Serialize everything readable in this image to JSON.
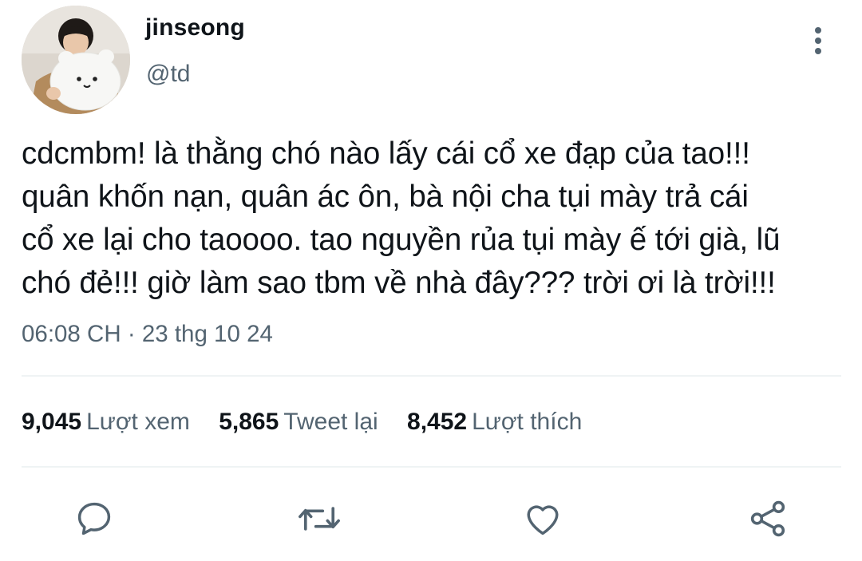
{
  "author": {
    "name": "jinseong",
    "handle": "@td",
    "avatar_icon": "user-photo-avatar"
  },
  "tweet": {
    "text": "cdcmbm! là thằng chó nào lấy cái cổ xe đạp của tao!!!\nquân khốn nạn, quân ác ôn, bà nội cha tụi mày trả cái\ncổ xe lại cho taoooo. tao nguyền rủa tụi mày ế tới già, lũ\nchó đẻ!!! giờ làm sao tbm về nhà đây??? trời ơi là trời!!!",
    "timestamp": "06:08 CH · 23 thg 10 24"
  },
  "stats": {
    "views": {
      "count": "9,045",
      "label": "Lượt xem"
    },
    "retweets": {
      "count": "5,865",
      "label": "Tweet lại"
    },
    "likes": {
      "count": "8,452",
      "label": "Lượt thích"
    }
  },
  "actions": {
    "reply_icon": "reply-icon",
    "retweet_icon": "retweet-icon",
    "like_icon": "heart-icon",
    "share_icon": "share-icon"
  },
  "colors": {
    "text_primary": "#0f1419",
    "text_secondary": "#536471",
    "icon": "#536471",
    "divider": "#eff3f4"
  }
}
